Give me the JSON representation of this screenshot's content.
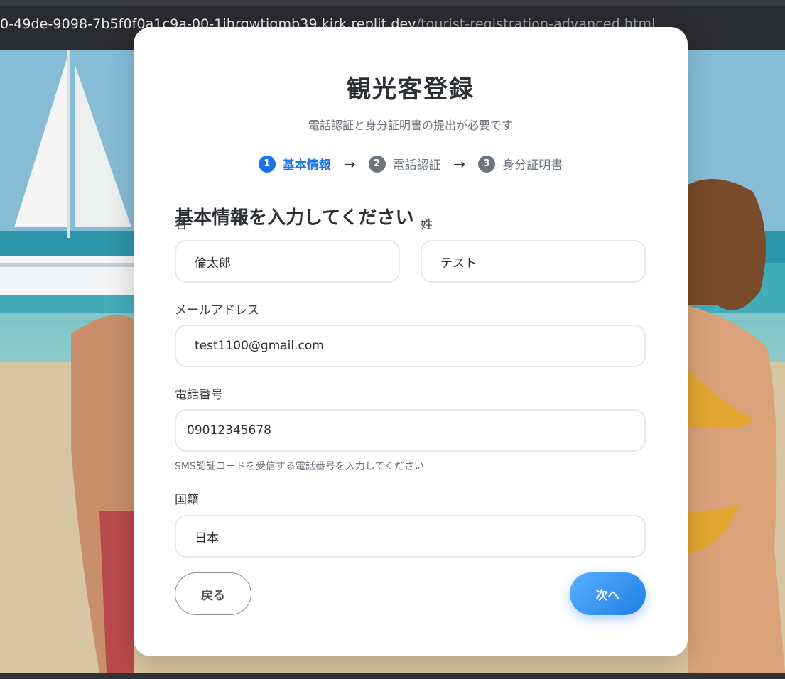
{
  "browser": {
    "url_host": "0-49de-9098-7b5f0f0a1c9a-00-1jhrgwtjgmb39.kirk.replit.dev",
    "url_path": "/tourist-registration-advanced.html"
  },
  "page": {
    "title": "観光客登録",
    "subtitle": "電話認証と身分証明書の提出が必要です"
  },
  "steps": [
    {
      "num": "1",
      "label": "基本情報",
      "active": true
    },
    {
      "num": "2",
      "label": "電話認証",
      "active": false
    },
    {
      "num": "3",
      "label": "身分証明書",
      "active": false
    }
  ],
  "step_arrow": "→",
  "form": {
    "heading": "基本情報を入力してください",
    "first_name": {
      "label": "名",
      "value": "倫太郎"
    },
    "last_name": {
      "label": "姓",
      "value": "テスト"
    },
    "email": {
      "label": "メールアドレス",
      "value": "test1100@gmail.com"
    },
    "phone": {
      "label": "電話番号",
      "value": "09012345678",
      "hint": "SMS認証コードを受信する電話番号を入力してください"
    },
    "nationality": {
      "label": "国籍",
      "value": "日本"
    }
  },
  "buttons": {
    "back": "戻る",
    "next": "次へ"
  },
  "colors": {
    "accent": "#1a73e8",
    "inactive_step": "#6c757d",
    "next_button_start": "#5ab0ff",
    "next_button_end": "#1e7fe6"
  }
}
